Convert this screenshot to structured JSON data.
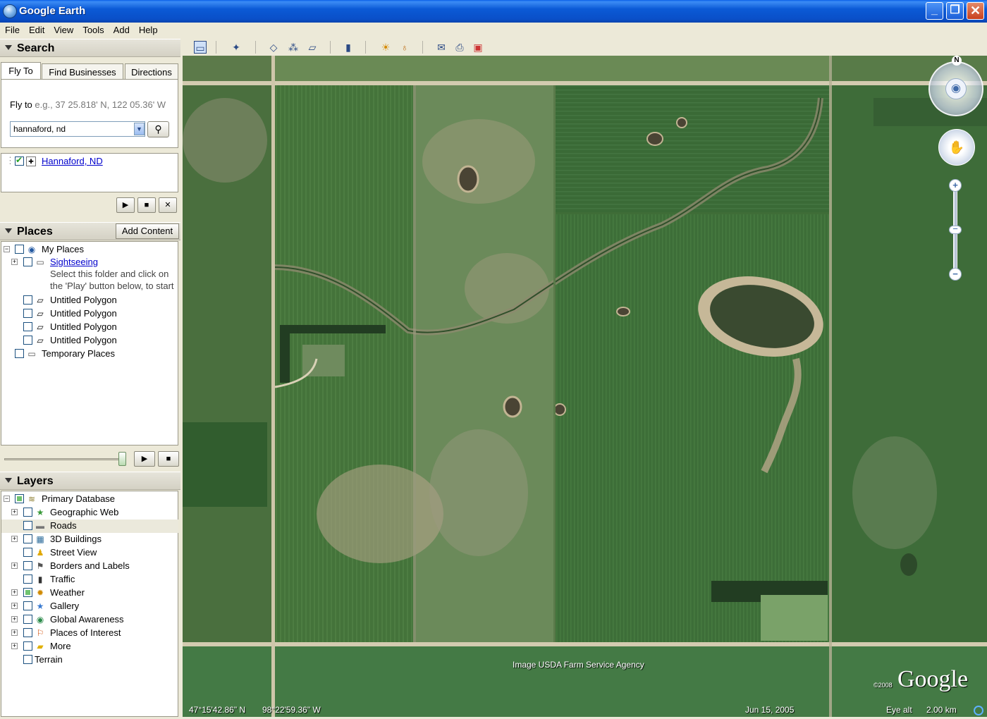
{
  "window": {
    "title": "Google Earth",
    "min": "_",
    "max": "❐",
    "close": "✕"
  },
  "menu": [
    "File",
    "Edit",
    "View",
    "Tools",
    "Add",
    "Help"
  ],
  "toolbar": {
    "icons": [
      "sidebar-icon",
      "placemark-icon",
      "polygon-icon",
      "path-icon",
      "overlay-icon",
      "ruler-icon",
      "sun-icon",
      "planet-icon",
      "email-icon",
      "print-icon",
      "maps-icon"
    ]
  },
  "search": {
    "title": "Search",
    "tabs": [
      "Fly To",
      "Find Businesses",
      "Directions"
    ],
    "fly_label": "Fly to",
    "fly_hint": "e.g., 37 25.818' N, 122 05.36' W",
    "input_value": "hannaford, nd",
    "result": "Hannaford, ND"
  },
  "places": {
    "title": "Places",
    "add_content": "Add Content",
    "items": [
      {
        "label": "My Places"
      },
      {
        "label": "Sightseeing"
      },
      {
        "label": "Select this folder and click on"
      },
      {
        "label": "the 'Play' button below, to start"
      },
      {
        "label": "Untitled Polygon"
      },
      {
        "label": "Untitled Polygon"
      },
      {
        "label": "Untitled Polygon"
      },
      {
        "label": "Untitled Polygon"
      },
      {
        "label": "Temporary Places"
      }
    ]
  },
  "layers": {
    "title": "Layers",
    "items": [
      {
        "label": "Primary Database"
      },
      {
        "label": "Geographic Web"
      },
      {
        "label": "Roads"
      },
      {
        "label": "3D Buildings"
      },
      {
        "label": "Street View"
      },
      {
        "label": "Borders and Labels"
      },
      {
        "label": "Traffic"
      },
      {
        "label": "Weather"
      },
      {
        "label": "Gallery"
      },
      {
        "label": "Global Awareness"
      },
      {
        "label": "Places of Interest"
      },
      {
        "label": "More"
      },
      {
        "label": "Terrain"
      }
    ]
  },
  "map": {
    "credit": "Image USDA Farm Service Agency",
    "logo": "Google",
    "copyright": "©2008",
    "compass_n": "N",
    "lat": "47°15'42.86\" N",
    "lon": "98°22'59.36\" W",
    "date": "Jun 15, 2005",
    "eye_alt_label": "Eye alt",
    "eye_alt_value": "2.00 km"
  }
}
